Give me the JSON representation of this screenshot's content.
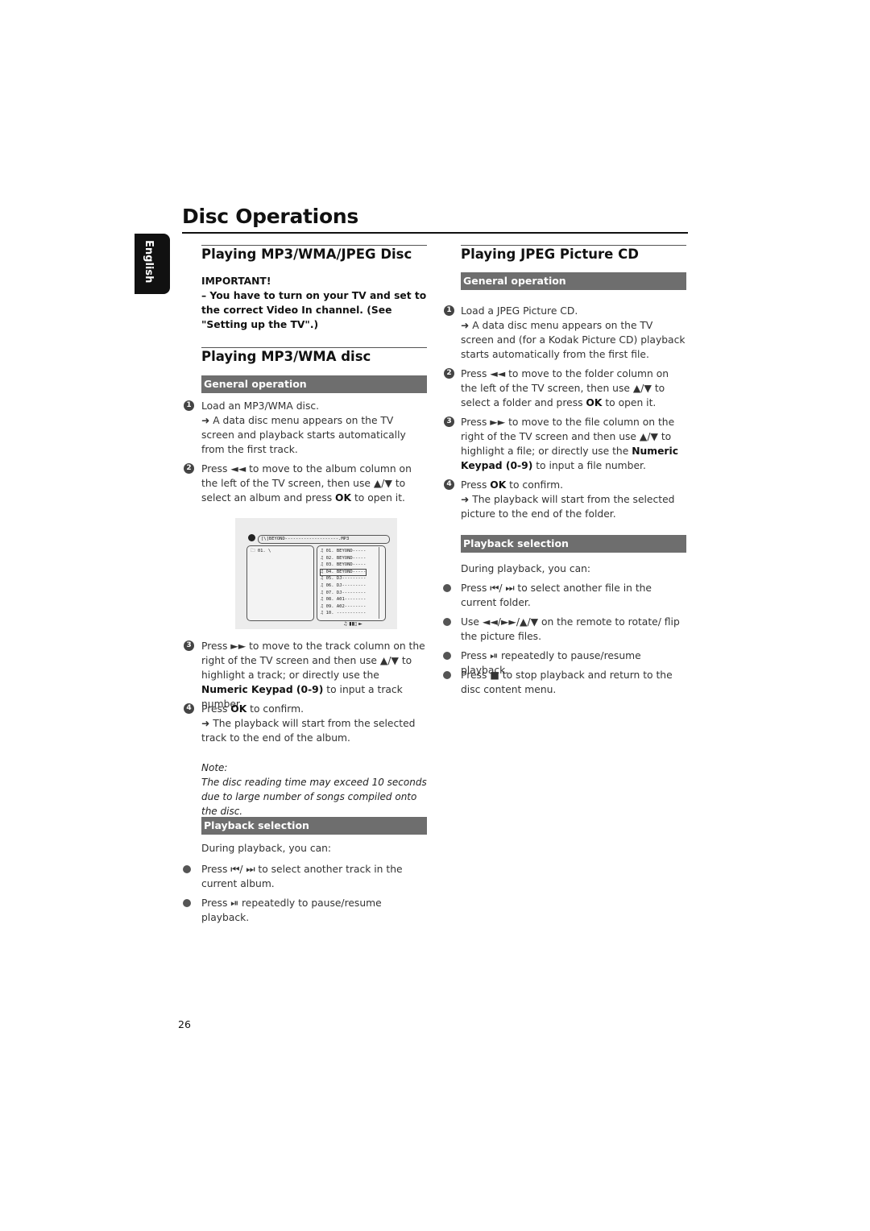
{
  "page": {
    "title": "Disc Operations",
    "language_tab": "English",
    "page_number": "26"
  },
  "left": {
    "heading1": "Playing MP3/WMA/JPEG Disc",
    "important_label": "IMPORTANT!",
    "important_text": "–  You have to turn on your TV and set to the correct Video In channel. (See \"Setting up the TV\".)",
    "heading2": "Playing MP3/WMA disc",
    "general_bar": "General operation",
    "steps": [
      {
        "num": "1",
        "html": "Load an MP3/WMA disc.<br>➜ A data disc menu appears on the TV screen and playback starts automatically from the first track."
      },
      {
        "num": "2",
        "html": "Press ◄◄  to move to the album column on the left of the TV screen, then use ▲/▼  to select an album and press <b>OK</b> to open it."
      },
      {
        "num": "3",
        "html": "Press ►► to move to the track column on the right of the TV screen and then use ▲/▼ to highlight a track; or directly use the <b>Numeric Keypad (0-9)</b> to input a track number."
      },
      {
        "num": "4",
        "html": "Press <b>OK</b> to confirm.<br>➜ The playback will start from the selected track to the end of the album."
      }
    ],
    "note_label": "Note:",
    "note_text": "The disc reading time may exceed 10 seconds due to large number of songs compiled onto the disc.",
    "playback_bar": "Playback selection",
    "playback_intro": "During playback, you can:",
    "playback_items": [
      "Press  ⏮/ ⏭  to select another track in the current album.",
      "Press ⏯ repeatedly to pause/resume playback."
    ]
  },
  "screen": {
    "path": "[\\]BEYOND--------------------.MP3",
    "folder": "01.  \\",
    "tracks": [
      "01.  BEYOND-----",
      "02.  BEYOND-----",
      "03.  BEYOND-----",
      "04.  BEYOND-----",
      "05.  DJ---------",
      "06.  DJ---------",
      "07.  DJ---------",
      "08.  A01--------",
      "09.  A02--------",
      "10.  -----------"
    ],
    "selected_index": 3,
    "status_icons": "♫  ▮▮▯  ►"
  },
  "right": {
    "heading": "Playing JPEG Picture CD",
    "general_bar": "General operation",
    "steps": [
      {
        "num": "1",
        "html": "Load a JPEG Picture CD.<br>➜ A data disc menu appears on the TV screen and (for a Kodak Picture CD) playback starts automatically from the first file."
      },
      {
        "num": "2",
        "html": "Press ◄◄  to move to the folder column on the left of the TV screen, then use ▲/▼ to select a folder and press <b>OK</b> to open it."
      },
      {
        "num": "3",
        "html": "Press ►► to move to the file column on the right of the TV screen and then use ▲/▼ to highlight a file; or directly use the <b>Numeric Keypad (0-9)</b> to input a file number."
      },
      {
        "num": "4",
        "html": "Press <b>OK</b> to confirm.<br>➜ The playback will start from the selected picture to the end of the folder."
      }
    ],
    "playback_bar": "Playback selection",
    "playback_intro": "During playback, you can:",
    "playback_items": [
      "Press  ⏮/ ⏭  to select another file in the current folder.",
      "Use ◄◄/►►/▲/▼ on the remote to rotate/ flip the picture files.",
      "Press ⏯ repeatedly to pause/resume playback.",
      "Press ■ to stop playback and return to the disc content menu."
    ]
  }
}
